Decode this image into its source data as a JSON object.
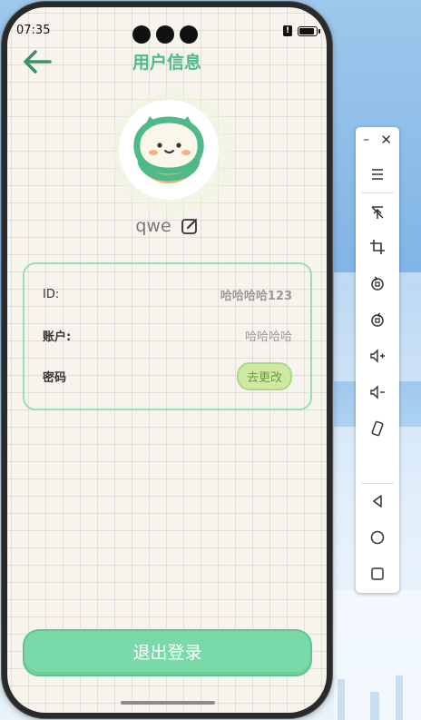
{
  "status_bar": {
    "time": "07:35"
  },
  "header": {
    "title": "用户信息"
  },
  "profile": {
    "username": "qwe"
  },
  "info": {
    "id_label": "ID:",
    "id_value": "哈哈哈哈123",
    "account_label": "账户:",
    "account_value": "哈哈哈哈",
    "password_label": "密码",
    "change_label": "去更改"
  },
  "logout": {
    "label": "退出登录"
  },
  "colors": {
    "accent": "#4fb98a",
    "card_border": "#9bdcbb",
    "logout_bg": "#7ad9a8",
    "change_bg": "#cfe9a4"
  },
  "emulator_toolbar": {
    "icons": [
      "minimize-icon",
      "close-icon",
      "menu-icon",
      "pin-off-icon",
      "crop-icon",
      "rotate-left-icon",
      "rotate-right-icon",
      "volume-up-icon",
      "volume-down-icon",
      "rotate-device-icon",
      "back-icon",
      "home-icon",
      "overview-icon"
    ]
  }
}
